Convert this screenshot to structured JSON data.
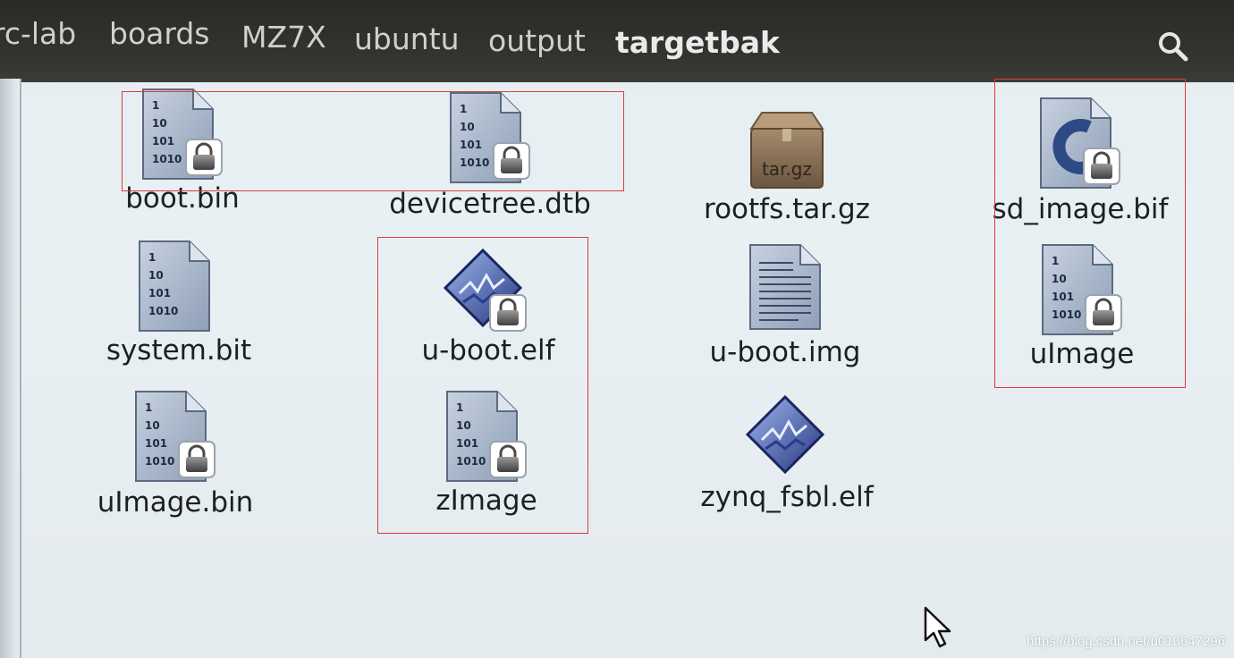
{
  "breadcrumb": [
    "rc-lab",
    "boards",
    "MZ7X",
    "ubuntu",
    "output",
    "targetbak"
  ],
  "files": [
    {
      "name": "boot.bin",
      "icon": "binary-file-locked-icon"
    },
    {
      "name": "devicetree.dtb",
      "icon": "binary-file-locked-icon"
    },
    {
      "name": "rootfs.tar.gz",
      "icon": "archive-box-icon",
      "icon_text": "tar.gz"
    },
    {
      "name": "sd_image.bif",
      "icon": "c-source-file-locked-icon"
    },
    {
      "name": "system.bit",
      "icon": "binary-file-icon"
    },
    {
      "name": "u-boot.elf",
      "icon": "executable-locked-icon"
    },
    {
      "name": "u-boot.img",
      "icon": "text-document-icon"
    },
    {
      "name": "uImage",
      "icon": "binary-file-locked-icon"
    },
    {
      "name": "uImage.bin",
      "icon": "binary-file-locked-icon"
    },
    {
      "name": "zImage",
      "icon": "binary-file-locked-icon"
    },
    {
      "name": "zynq_fsbl.elf",
      "icon": "executable-icon"
    }
  ],
  "watermark": "https://blog.csdn.net/u010647296",
  "colors": {
    "toolbar": "#2f302c",
    "background": "#e7eef2",
    "highlight": "#e03a3a"
  }
}
